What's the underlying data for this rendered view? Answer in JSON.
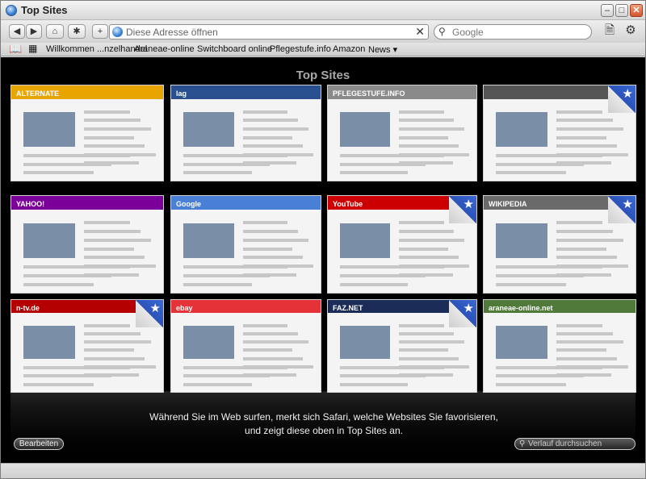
{
  "window": {
    "title": "Top Sites"
  },
  "toolbar": {
    "address_placeholder": "Diese Adresse öffnen",
    "search_placeholder": "Google"
  },
  "bookmarks": [
    "Willkommen ...nzelhandel",
    "Araneae-online",
    "Switchboard online",
    "Pflegestufe.info",
    "Amazon",
    "News"
  ],
  "topsites": {
    "heading": "Top Sites",
    "info_text": "Während Sie im Web surfen, merkt sich Safari, welche Websites Sie favorisieren, und zeigt diese oben in Top Sites an.",
    "edit_label": "Bearbeiten",
    "history_placeholder": "Verlauf durchsuchen",
    "thumbnails": [
      {
        "label": "ALTERNATE",
        "accent": "#e8a500",
        "starred": false
      },
      {
        "label": "lag",
        "accent": "#2a4f8e",
        "starred": false
      },
      {
        "label": "PFLEGESTUFE.INFO",
        "accent": "#8a8a8a",
        "starred": false
      },
      {
        "label": "",
        "accent": "#555555",
        "starred": true
      },
      {
        "label": "YAHOO!",
        "accent": "#7b0099",
        "starred": false
      },
      {
        "label": "Google",
        "accent": "#4a7fd6",
        "starred": false
      },
      {
        "label": "YouTube",
        "accent": "#cc0000",
        "starred": true
      },
      {
        "label": "WIKIPEDIA",
        "accent": "#6a6a6a",
        "starred": true
      },
      {
        "label": "n-tv.de",
        "accent": "#b40000",
        "starred": true
      },
      {
        "label": "ebay",
        "accent": "#e53238",
        "starred": false
      },
      {
        "label": "FAZ.NET",
        "accent": "#1a2c57",
        "starred": true
      },
      {
        "label": "araneae-online.net",
        "accent": "#4f7a3a",
        "starred": false
      }
    ]
  },
  "colors": {
    "accent_blue": "#2c53b8",
    "background": "#000000"
  }
}
